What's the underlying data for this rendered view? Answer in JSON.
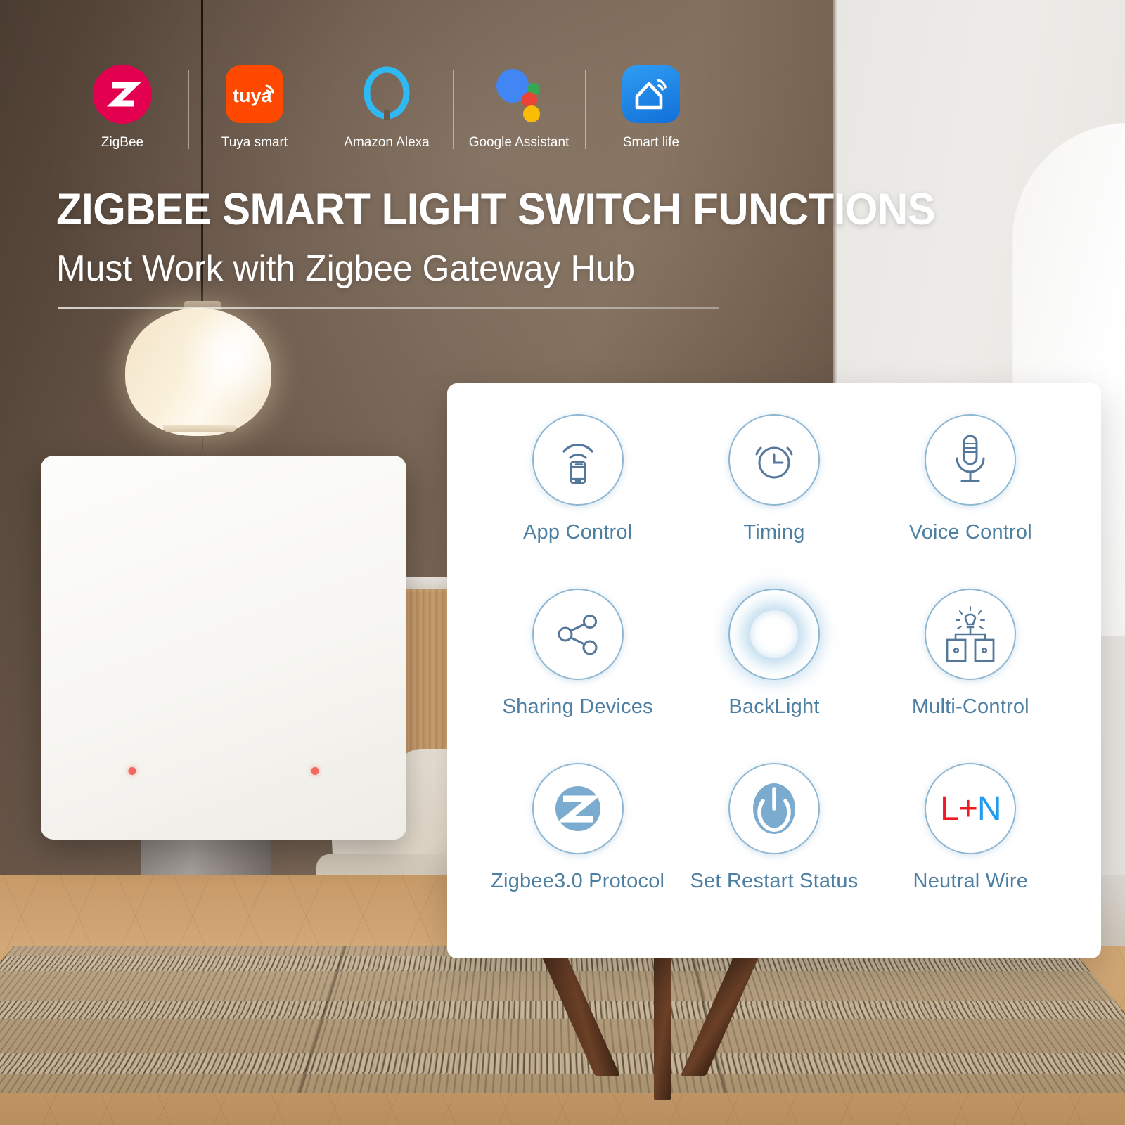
{
  "headline": "ZIGBEE SMART LIGHT SWITCH FUNCTIONS",
  "subheadline": "Must Work with Zigbee Gateway Hub",
  "colors": {
    "accent_blue": "#4d7fa3",
    "circle_border": "#8fb7d2",
    "zigbee_red": "#e3004f",
    "tuya_orange": "#ff4800",
    "alexa_blue": "#2fb9f2",
    "smartlife_blue": "#2f9df4",
    "wire_live_red": "#ee1b23",
    "wire_neutral_blue": "#1f9cf0",
    "led_red": "#f4675f",
    "wall_brown": "#6b5848",
    "wall_light": "#e8e6e2",
    "floor_wood": "#caa070"
  },
  "logos": [
    {
      "caption": "ZigBee",
      "icon": "zigbee-logo-icon"
    },
    {
      "caption": "Tuya smart",
      "icon": "tuya-logo-icon"
    },
    {
      "caption": "Amazon Alexa",
      "icon": "alexa-logo-icon"
    },
    {
      "caption": "Google Assistant",
      "icon": "google-assistant-logo-icon"
    },
    {
      "caption": "Smart life",
      "icon": "smart-life-logo-icon"
    }
  ],
  "features": [
    {
      "label": "App Control",
      "icon": "app-control-icon"
    },
    {
      "label": "Timing",
      "icon": "alarm-clock-icon"
    },
    {
      "label": "Voice Control",
      "icon": "microphone-icon"
    },
    {
      "label": "Sharing Devices",
      "icon": "share-nodes-icon"
    },
    {
      "label": "BackLight",
      "icon": "backlight-ring-icon"
    },
    {
      "label": "Multi-Control",
      "icon": "multi-control-icon"
    },
    {
      "label": "Zigbee3.0 Protocol",
      "icon": "zigbee-z-icon"
    },
    {
      "label": "Set Restart Status",
      "icon": "power-button-icon"
    },
    {
      "label": "Neutral Wire",
      "icon": "l-plus-n-icon"
    }
  ],
  "neutral_wire": {
    "live": "L",
    "plus": "+",
    "neutral": "N"
  },
  "product": {
    "name": "two-gang-smart-light-switch",
    "gang_count": 2
  }
}
